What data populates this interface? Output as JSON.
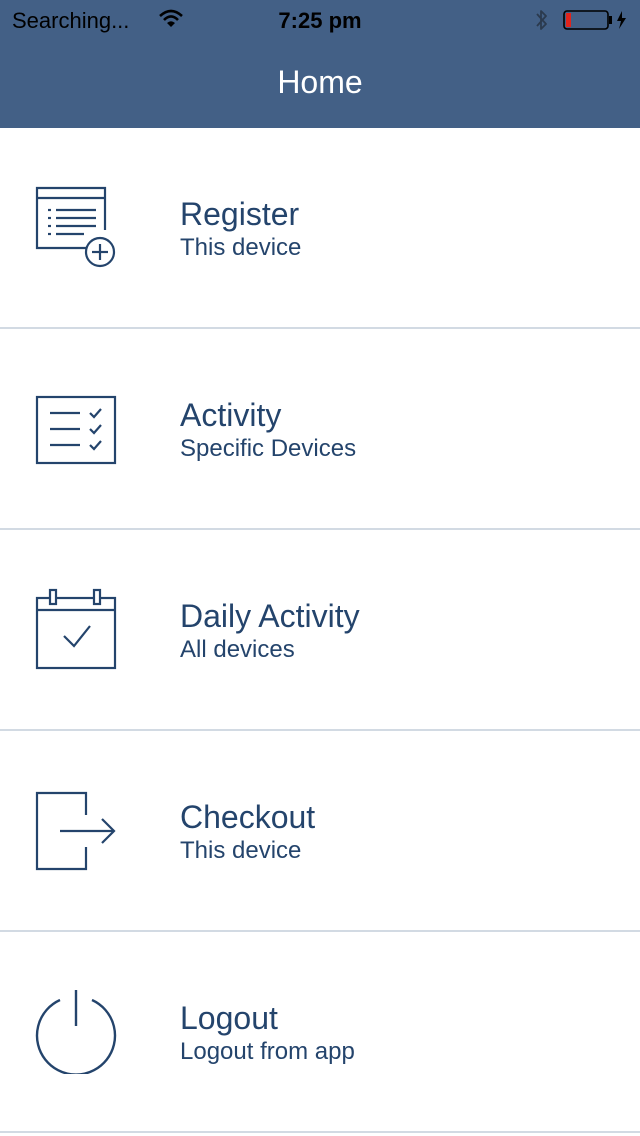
{
  "status_bar": {
    "carrier": "Searching...",
    "time": "7:25 pm",
    "icons": [
      "wifi-icon",
      "bluetooth-icon",
      "battery-icon",
      "charging-icon"
    ]
  },
  "nav": {
    "title": "Home"
  },
  "colors": {
    "header_bg": "#436086",
    "text": "#24446c",
    "divider": "#d2dae3",
    "battery_low": "#e0241c"
  },
  "menu": [
    {
      "title": "Register",
      "subtitle": "This device",
      "icon": "register-list-add-icon"
    },
    {
      "title": "Activity",
      "subtitle": "Specific Devices",
      "icon": "checklist-icon"
    },
    {
      "title": "Daily Activity",
      "subtitle": "All devices",
      "icon": "calendar-check-icon"
    },
    {
      "title": "Checkout",
      "subtitle": "This device",
      "icon": "exit-arrow-icon"
    },
    {
      "title": "Logout",
      "subtitle": "Logout from app",
      "icon": "power-icon"
    }
  ]
}
